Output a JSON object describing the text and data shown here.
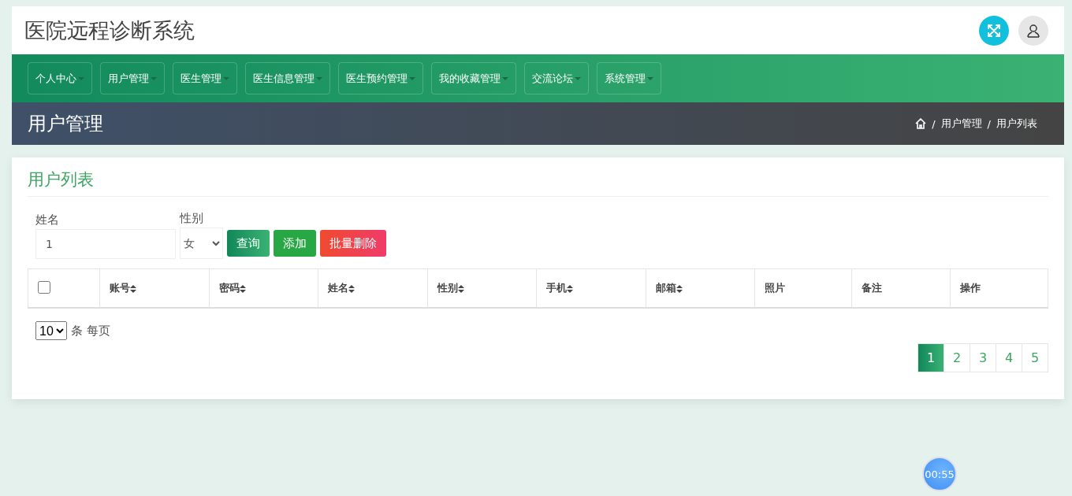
{
  "header": {
    "title": "医院远程诊断系统"
  },
  "nav": {
    "items": [
      {
        "label": "个人中心"
      },
      {
        "label": "用户管理"
      },
      {
        "label": "医生管理"
      },
      {
        "label": "医生信息管理"
      },
      {
        "label": "医生预约管理"
      },
      {
        "label": "我的收藏管理"
      },
      {
        "label": "交流论坛"
      },
      {
        "label": "系统管理"
      }
    ]
  },
  "banner": {
    "title": "用户管理",
    "breadcrumb": [
      "用户管理",
      "用户列表"
    ],
    "separator": "/"
  },
  "card": {
    "title": "用户列表",
    "filters": [
      {
        "kind": "input",
        "label": "姓名",
        "value": "1"
      },
      {
        "kind": "select",
        "label": "性别",
        "value": "女"
      }
    ],
    "buttons": [
      {
        "kind": "search",
        "label": "查询"
      },
      {
        "kind": "add",
        "label": "添加"
      },
      {
        "kind": "delete",
        "label": "批量删除"
      }
    ],
    "table": {
      "select_all": {
        "checked": false
      },
      "columns": [
        {
          "label": "账号",
          "sortable": true
        },
        {
          "label": "密码",
          "sortable": true
        },
        {
          "label": "姓名",
          "sortable": true
        },
        {
          "label": "性别",
          "sortable": true
        },
        {
          "label": "手机",
          "sortable": true
        },
        {
          "label": "邮箱",
          "sortable": true
        },
        {
          "label": "照片",
          "sortable": false
        },
        {
          "label": "备注",
          "sortable": false
        },
        {
          "label": "操作",
          "sortable": false
        }
      ]
    },
    "page_size": {
      "value": "10",
      "label": "条 每页"
    },
    "pages": [
      {
        "label": "1",
        "selected": true
      },
      {
        "label": "2",
        "selected": false
      },
      {
        "label": "3",
        "selected": false
      },
      {
        "label": "4",
        "selected": false
      },
      {
        "label": "5",
        "selected": false
      }
    ]
  },
  "timer": "00:55"
}
